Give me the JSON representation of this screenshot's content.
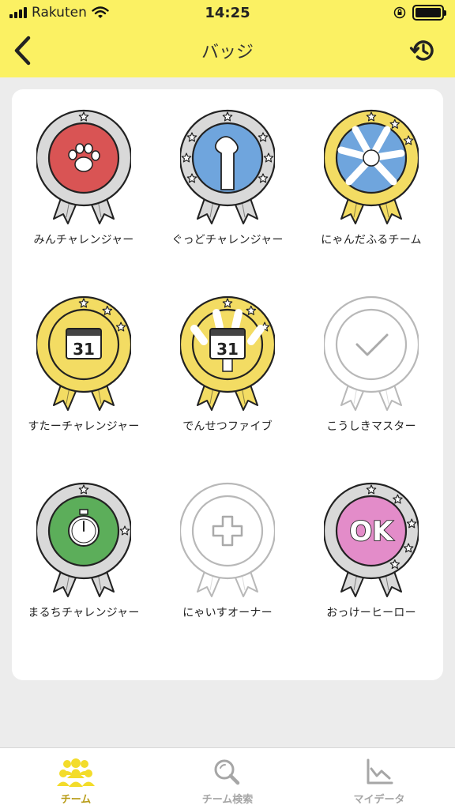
{
  "status_bar": {
    "carrier": "Rakuten",
    "time": "14:25"
  },
  "nav": {
    "title": "バッジ",
    "back_icon": "chevron-left-icon",
    "history_icon": "history-icon"
  },
  "colors": {
    "header": "#fbf163",
    "active_tab": "#b99d1a",
    "gold": "#f3dc63",
    "silver": "#d9d9d9"
  },
  "badges": [
    {
      "label": "みんチャレンジャー",
      "tier": "silver",
      "motif": "paw",
      "center_color": "#d95454",
      "earned": true
    },
    {
      "label": "ぐっどチャレンジャー",
      "tier": "silver",
      "motif": "thumbs-up",
      "center_color": "#6fa5dd",
      "earned": true
    },
    {
      "label": "にゃんだふるチーム",
      "tier": "gold",
      "motif": "team-hands",
      "center_color": "#6fa5dd",
      "earned": true
    },
    {
      "label": "すたーチャレンジャー",
      "tier": "gold",
      "motif": "calendar",
      "calendar_text": "31",
      "center_color": "#f3dc63",
      "earned": true
    },
    {
      "label": "でんせつファイブ",
      "tier": "gold",
      "motif": "calendar-hands",
      "calendar_text": "31",
      "center_color": "#f3dc63",
      "earned": true
    },
    {
      "label": "こうしきマスター",
      "tier": "locked",
      "motif": "check",
      "center_color": "#ffffff",
      "earned": false
    },
    {
      "label": "まるちチャレンジャー",
      "tier": "silver",
      "motif": "stopwatch",
      "center_color": "#5cae5a",
      "earned": true
    },
    {
      "label": "にゃいすオーナー",
      "tier": "locked",
      "motif": "plus",
      "center_color": "#ffffff",
      "earned": false
    },
    {
      "label": "おっけーヒーロー",
      "tier": "silver",
      "motif": "ok",
      "ok_text": "OK",
      "center_color": "#e38cc9",
      "earned": true
    }
  ],
  "tabs": [
    {
      "label": "チーム",
      "icon": "team-icon",
      "active": true
    },
    {
      "label": "チーム検索",
      "icon": "search-icon",
      "active": false
    },
    {
      "label": "マイデータ",
      "icon": "chart-icon",
      "active": false
    }
  ]
}
